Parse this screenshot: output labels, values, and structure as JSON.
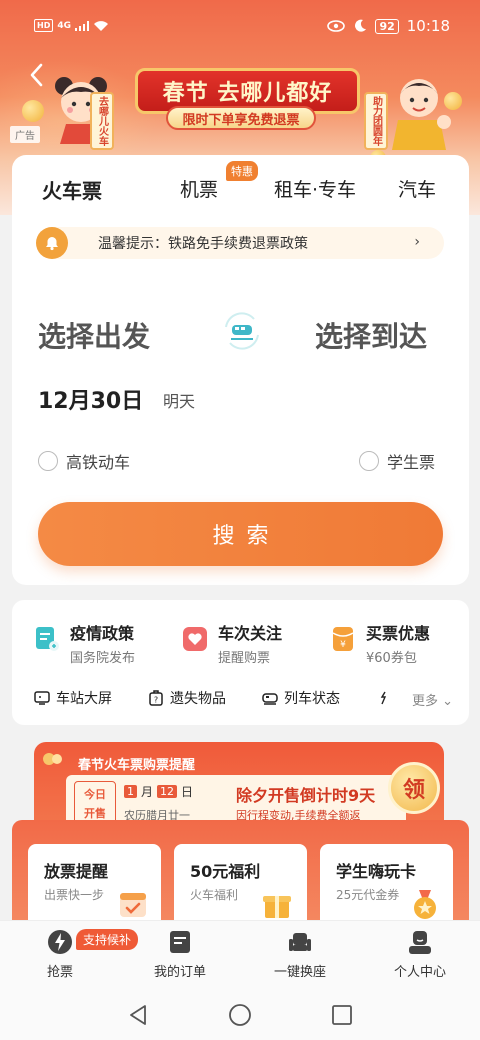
{
  "status_bar": {
    "hd": "HD",
    "signal": "4G",
    "battery": "92",
    "time": "10:18"
  },
  "banner": {
    "title": "春节 去哪儿都好",
    "subtitle": "限时下单享免费退票",
    "left_scroll": "去哪儿火车",
    "right_scroll": "助力团圆年",
    "ad_tag": "广告"
  },
  "tabs": [
    {
      "label": "火车票",
      "active": true
    },
    {
      "label": "机票",
      "active": false
    },
    {
      "label": "租车·专车",
      "active": false
    },
    {
      "label": "汽车",
      "active": false
    }
  ],
  "tab_badge": "特惠",
  "notice": {
    "text": "温馨提示：铁路免手续费退票政策",
    "arrow": "›"
  },
  "route": {
    "from": "选择出发",
    "to": "选择到达"
  },
  "date": {
    "value": "12月30日",
    "sub": "明天"
  },
  "options": {
    "high_speed": "高铁动车",
    "student": "学生票"
  },
  "search_label": "搜索",
  "services": [
    {
      "title": "疫情政策",
      "sub": "国务院发布"
    },
    {
      "title": "车次关注",
      "sub": "提醒购票"
    },
    {
      "title": "买票优惠",
      "sub": "¥60券包"
    }
  ],
  "quick_links": [
    "车站大屏",
    "遗失物品",
    "列车状态"
  ],
  "more_label": "更多",
  "promo": {
    "head": "春节火车票购票提醒",
    "today_line1": "今日",
    "today_line2": "开售",
    "month": "1",
    "month_unit": "月",
    "day": "12",
    "day_unit": "日",
    "lunar": "农历腊月廿一",
    "countdown_title": "除夕开售倒计时9天",
    "countdown_sub": "因行程变动,手续费全额返",
    "claim": "领"
  },
  "promo_cards": [
    {
      "title": "放票提醒",
      "sub": "出票快一步"
    },
    {
      "title": "50元福利",
      "sub": "火车福利"
    },
    {
      "title": "学生嗨玩卡",
      "sub": "25元代金券"
    }
  ],
  "bottom_nav": {
    "badge": "支持候补",
    "items": [
      "抢票",
      "我的订单",
      "一键换座",
      "个人中心"
    ]
  },
  "colors": {
    "accent": "#f07a36",
    "brand_red": "#e2332a",
    "notice_bg": "#fff6ea"
  }
}
